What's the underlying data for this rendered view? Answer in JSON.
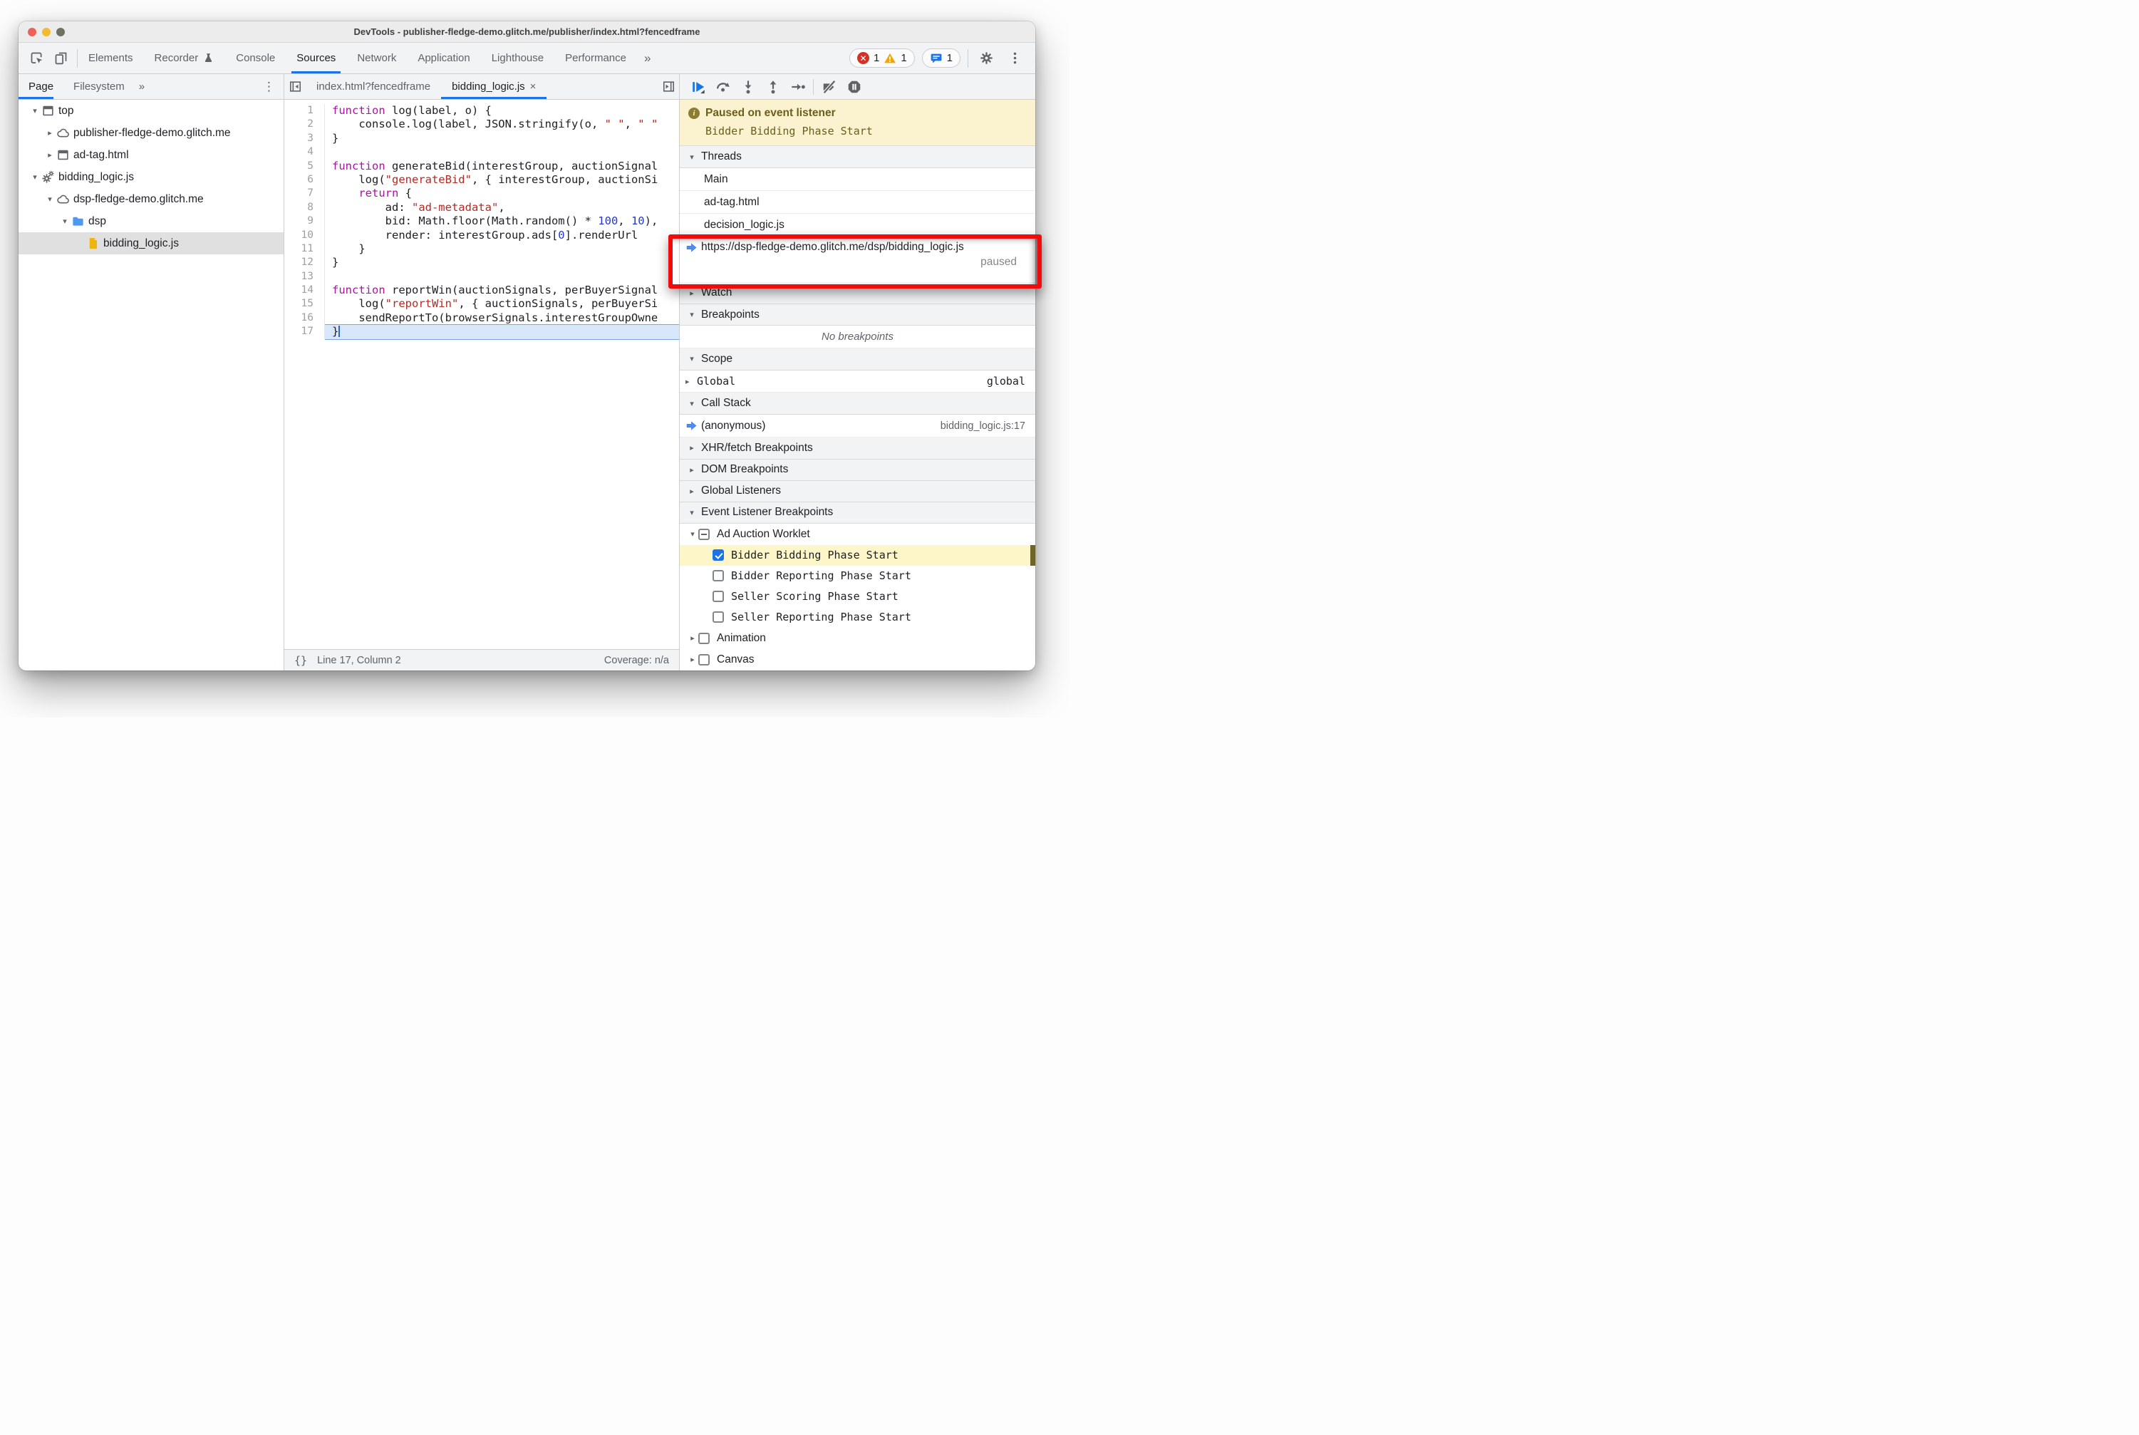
{
  "colors": {
    "accent": "#1a73e8",
    "annotation_red": "#ee0c0c",
    "paused_bg": "#fbf3d0",
    "paused_text": "#6a5f1c",
    "line_highlight": "#d9e7fb",
    "elb_highlight": "#fcf6c8",
    "tok_keyword": "#a912a3",
    "tok_string": "#b52a23",
    "tok_number": "#2537cd",
    "tl_red": "#ee6158",
    "tl_yellow": "#f3bb2f",
    "tl_green": "#6f7163"
  },
  "window": {
    "title": "DevTools - publisher-fledge-demo.glitch.me/publisher/index.html?fencedframe"
  },
  "toolbar": {
    "tabs": [
      {
        "label": "Elements"
      },
      {
        "label": "Recorder",
        "flask": true
      },
      {
        "label": "Console"
      },
      {
        "label": "Sources",
        "active": true
      },
      {
        "label": "Network"
      },
      {
        "label": "Application"
      },
      {
        "label": "Lighthouse"
      },
      {
        "label": "Performance"
      }
    ],
    "overflow": "»",
    "badges": {
      "error_count": "1",
      "warning_count": "1",
      "message_count": "1"
    }
  },
  "sidebar": {
    "tabs": {
      "page": "Page",
      "filesystem": "Filesystem",
      "overflow": "»",
      "menu": "⋮"
    },
    "tree": [
      {
        "depth": 0,
        "arrow": "down",
        "icon": "frame",
        "label": "top"
      },
      {
        "depth": 1,
        "arrow": "right",
        "icon": "cloud",
        "label": "publisher-fledge-demo.glitch.me"
      },
      {
        "depth": 1,
        "arrow": "right",
        "icon": "frame",
        "label": "ad-tag.html"
      },
      {
        "depth": 0,
        "arrow": "down",
        "icon": "worklet",
        "label": "bidding_logic.js"
      },
      {
        "depth": 1,
        "arrow": "down",
        "icon": "cloud",
        "label": "dsp-fledge-demo.glitch.me"
      },
      {
        "depth": 2,
        "arrow": "down",
        "icon": "folder",
        "label": "dsp"
      },
      {
        "depth": 3,
        "arrow": "none",
        "icon": "file",
        "label": "bidding_logic.js",
        "selected": true
      }
    ]
  },
  "editor": {
    "tabs": [
      {
        "label": "index.html?fencedframe"
      },
      {
        "label": "bidding_logic.js",
        "close": "×",
        "active": true
      }
    ],
    "lines": [
      {
        "n": 1,
        "tokens": [
          [
            "kw",
            "function"
          ],
          [
            "pl",
            " log(label, o) {"
          ]
        ]
      },
      {
        "n": 2,
        "tokens": [
          [
            "pl",
            "    console.log(label, JSON.stringify(o, "
          ],
          [
            "str",
            "\" \""
          ],
          [
            "pl",
            ", "
          ],
          [
            "str",
            "\" \""
          ]
        ]
      },
      {
        "n": 3,
        "tokens": [
          [
            "pl",
            "}"
          ]
        ]
      },
      {
        "n": 4,
        "tokens": []
      },
      {
        "n": 5,
        "tokens": [
          [
            "kw",
            "function"
          ],
          [
            "pl",
            " generateBid(interestGroup, auctionSignal"
          ]
        ]
      },
      {
        "n": 6,
        "tokens": [
          [
            "pl",
            "    log("
          ],
          [
            "str",
            "\"generateBid\""
          ],
          [
            "pl",
            ", { interestGroup, auctionSi"
          ]
        ]
      },
      {
        "n": 7,
        "tokens": [
          [
            "pl",
            "    "
          ],
          [
            "kw",
            "return"
          ],
          [
            "pl",
            " {"
          ]
        ]
      },
      {
        "n": 8,
        "tokens": [
          [
            "pl",
            "        ad: "
          ],
          [
            "str",
            "\"ad-metadata\""
          ],
          [
            "pl",
            ","
          ]
        ]
      },
      {
        "n": 9,
        "tokens": [
          [
            "pl",
            "        bid: Math.floor(Math.random() * "
          ],
          [
            "num",
            "100"
          ],
          [
            "pl",
            ", "
          ],
          [
            "num",
            "10"
          ],
          [
            "pl",
            "),"
          ]
        ]
      },
      {
        "n": 10,
        "tokens": [
          [
            "pl",
            "        render: interestGroup.ads["
          ],
          [
            "num",
            "0"
          ],
          [
            "pl",
            "].renderUrl"
          ]
        ]
      },
      {
        "n": 11,
        "tokens": [
          [
            "pl",
            "    }"
          ]
        ]
      },
      {
        "n": 12,
        "tokens": [
          [
            "pl",
            "}"
          ]
        ]
      },
      {
        "n": 13,
        "tokens": []
      },
      {
        "n": 14,
        "tokens": [
          [
            "kw",
            "function"
          ],
          [
            "pl",
            " reportWin(auctionSignals, perBuyerSignal"
          ]
        ]
      },
      {
        "n": 15,
        "tokens": [
          [
            "pl",
            "    log("
          ],
          [
            "str",
            "\"reportWin\""
          ],
          [
            "pl",
            ", { auctionSignals, perBuyerSi"
          ]
        ]
      },
      {
        "n": 16,
        "tokens": [
          [
            "pl",
            "    sendReportTo(browserSignals.interestGroupOwne"
          ]
        ]
      },
      {
        "n": 17,
        "tokens": [
          [
            "pl",
            "}"
          ]
        ],
        "highlight": true
      }
    ],
    "status": {
      "braces": "{}",
      "line_info": "Line 17, Column 2",
      "coverage": "Coverage: n/a"
    }
  },
  "debugger_toolbar": {
    "buttons": [
      {
        "name": "resume"
      },
      {
        "name": "step-over"
      },
      {
        "name": "step-into"
      },
      {
        "name": "step-out"
      },
      {
        "name": "step"
      },
      {
        "name": "divider"
      },
      {
        "name": "deactivate-breakpoints"
      },
      {
        "name": "pause-on-exceptions"
      }
    ]
  },
  "debugger_panel": {
    "banner": {
      "title": "Paused on event listener",
      "detail": "Bidder Bidding Phase Start"
    },
    "threads": {
      "title": "Threads",
      "items": [
        {
          "label": "Main"
        },
        {
          "label": "ad-tag.html"
        },
        {
          "label": "decision_logic.js"
        },
        {
          "label": "https://dsp-fledge-demo.glitch.me/dsp/bidding_logic.js",
          "status": "paused",
          "active": true
        }
      ]
    },
    "watch": {
      "title": "Watch"
    },
    "breakpoints": {
      "title": "Breakpoints",
      "empty": "No breakpoints"
    },
    "scope": {
      "title": "Scope",
      "rows": [
        {
          "label": "Global",
          "value": "global"
        }
      ]
    },
    "call_stack": {
      "title": "Call Stack",
      "rows": [
        {
          "label": "(anonymous)",
          "location": "bidding_logic.js:17",
          "active": true
        }
      ]
    },
    "xhr_breakpoints": {
      "title": "XHR/fetch Breakpoints"
    },
    "dom_breakpoints": {
      "title": "DOM Breakpoints"
    },
    "global_listeners": {
      "title": "Global Listeners"
    },
    "event_listener_breakpoints": {
      "title": "Event Listener Breakpoints",
      "rows": [
        {
          "kind": "group",
          "arrow": "down",
          "checkbox": "indeterminate",
          "label": "Ad Auction Worklet"
        },
        {
          "kind": "leaf",
          "checkbox": "checked",
          "label": "Bidder Bidding Phase Start",
          "highlighted": true
        },
        {
          "kind": "leaf",
          "checkbox": "unchecked",
          "label": "Bidder Reporting Phase Start"
        },
        {
          "kind": "leaf",
          "checkbox": "unchecked",
          "label": "Seller Scoring Phase Start"
        },
        {
          "kind": "leaf",
          "checkbox": "unchecked",
          "label": "Seller Reporting Phase Start"
        },
        {
          "kind": "group",
          "arrow": "right",
          "checkbox": "unchecked",
          "label": "Animation"
        },
        {
          "kind": "group",
          "arrow": "right",
          "checkbox": "unchecked",
          "label": "Canvas"
        }
      ]
    }
  }
}
